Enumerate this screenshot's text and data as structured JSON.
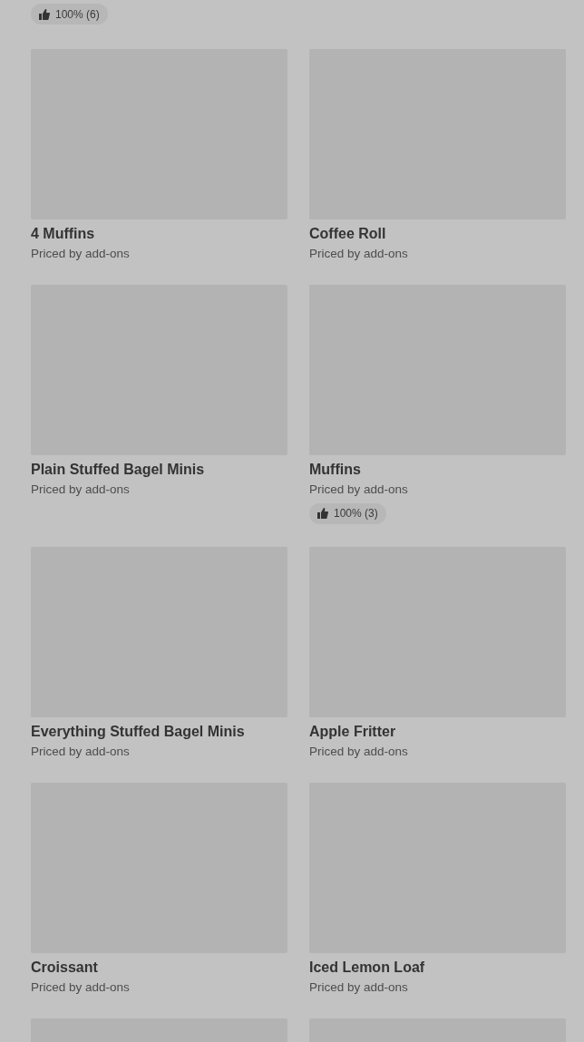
{
  "top_rating": "100% (6)",
  "items": [
    {
      "kind": "product",
      "name": "4 Muffins",
      "subtitle": "Priced by add-ons"
    },
    {
      "kind": "product",
      "name": "Coffee Roll",
      "subtitle": "Priced by add-ons"
    },
    {
      "kind": "product",
      "name": "Plain Stuffed Bagel Minis",
      "subtitle": "Priced by add-ons"
    },
    {
      "kind": "product",
      "name": "Muffins",
      "subtitle": "Priced by add-ons",
      "rating": "100% (3)"
    },
    {
      "kind": "product",
      "name": "Everything Stuffed Bagel Minis",
      "subtitle": "Priced by add-ons"
    },
    {
      "kind": "product",
      "name": "Apple Fritter",
      "subtitle": "Priced by add-ons"
    },
    {
      "kind": "product",
      "name": "Croissant",
      "subtitle": "Priced by add-ons"
    },
    {
      "kind": "product",
      "name": "Iced Lemon Loaf",
      "subtitle": "Priced by add-ons"
    },
    {
      "kind": "image-only"
    },
    {
      "kind": "image-only"
    }
  ]
}
